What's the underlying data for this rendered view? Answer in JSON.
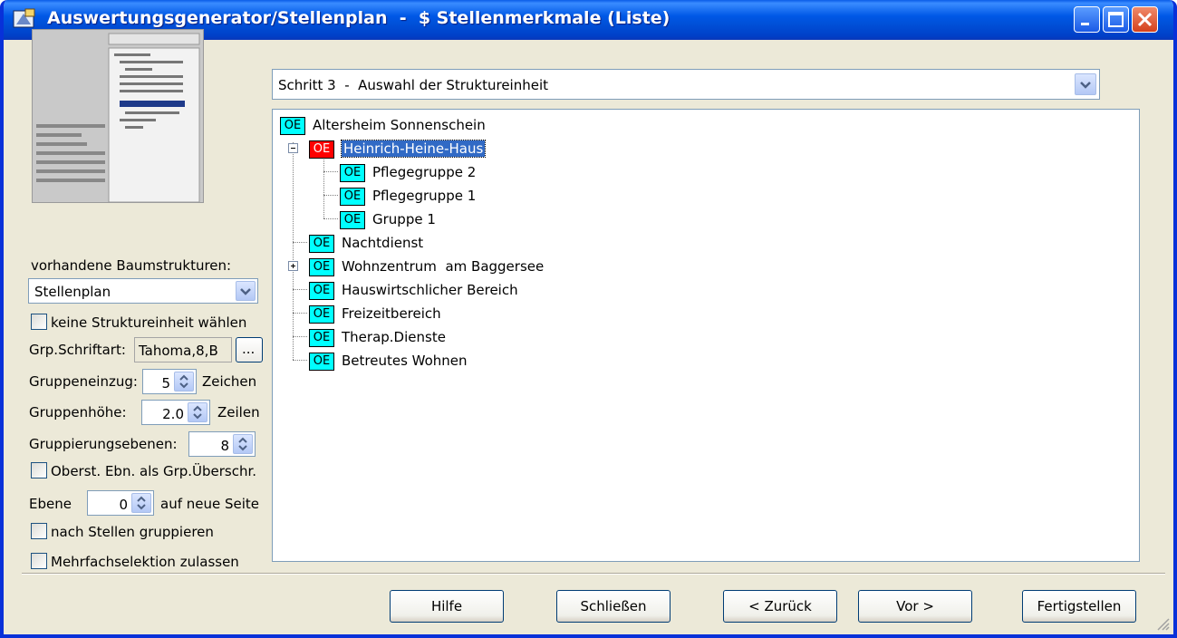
{
  "window": {
    "title": "Auswertungsgenerator/Stellenplan  -  $ Stellenmerkmale (Liste)"
  },
  "left": {
    "baum_label": "vorhandene Baumstrukturen:",
    "baum_value": "Stellenplan",
    "keine_label": "keine Struktureinheit wählen",
    "schriftart_label": "Grp.Schriftart:",
    "schriftart_value": "Tahoma,8,B",
    "dots_label": "...",
    "einzug_label": "Gruppeneinzug:",
    "einzug_value": "5",
    "einzug_unit": "Zeichen",
    "hoehe_label": "Gruppenhöhe:",
    "hoehe_value": "2.0",
    "hoehe_unit": "Zeilen",
    "ebenen_label": "Gruppierungsebenen:",
    "ebenen_value": "8",
    "oberst_label": "Oberst. Ebn. als Grp.Überschr.",
    "ebene_label": "Ebene",
    "ebene_value": "0",
    "ebene_unit": "auf neue Seite",
    "stellen_label": "nach Stellen gruppieren",
    "mehrfach_label": "Mehrfachselektion zulassen"
  },
  "step": {
    "value": "Schritt 3  -  Auswahl der Struktureinheit"
  },
  "tree": {
    "badge": "OE",
    "nodes": [
      {
        "label": "Altersheim Sonnenschein"
      },
      {
        "label": "Heinrich-Heine-Haus"
      },
      {
        "label": "Pflegegruppe 2"
      },
      {
        "label": "Pflegegruppe 1"
      },
      {
        "label": "Gruppe 1"
      },
      {
        "label": "Nachtdienst"
      },
      {
        "label": "Wohnzentrum  am Baggersee"
      },
      {
        "label": "Hauswirtschlicher Bereich"
      },
      {
        "label": "Freizeitbereich"
      },
      {
        "label": "Therap.Dienste"
      },
      {
        "label": "Betreutes Wohnen"
      }
    ]
  },
  "buttons": {
    "hilfe": "Hilfe",
    "schliessen": "Schließen",
    "zurueck": "< Zurück",
    "vor": "Vor >",
    "fertig": "Fertigstellen"
  },
  "colors": {
    "titlebar": "#0058e6",
    "oe_badge": "#00ffff",
    "oe_badge_selected": "#ff0000",
    "selection": "#316ac5"
  }
}
